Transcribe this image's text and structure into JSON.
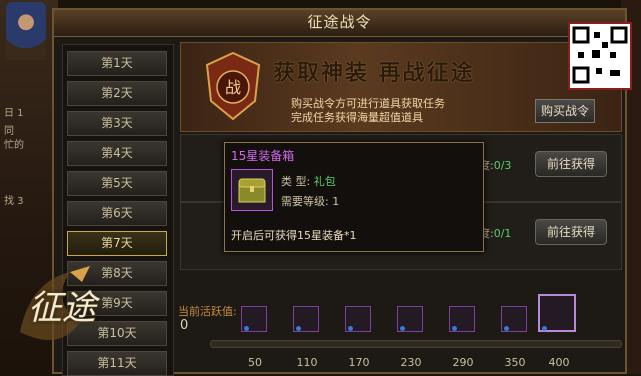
{
  "window": {
    "title": "征途战令"
  },
  "days": [
    "第1天",
    "第2天",
    "第3天",
    "第4天",
    "第5天",
    "第6天",
    "第7天",
    "第8天",
    "第9天",
    "第10天",
    "第11天"
  ],
  "active_day": "第7天",
  "banner": {
    "title": "获取神装 再战征途",
    "emblem_char": "战",
    "line1": "购买战令方可进行道具获取任务",
    "line2": "完成任务获得海量超值道具",
    "buy_button": "购买战令"
  },
  "tasks": [
    {
      "progress_label": "度:",
      "progress_value": "0/3",
      "button": "前往获得"
    },
    {
      "progress_label": "度:",
      "progress_value": "0/1",
      "button": "前往获得"
    }
  ],
  "tooltip": {
    "title": "15星装备箱",
    "type_label": "类 型:",
    "type_value": "礼包",
    "level_label": "需要等级:",
    "level_value": "1",
    "description": "开启后可获得15星装备*1"
  },
  "activity": {
    "label": "当前活跃值:",
    "value": "0",
    "milestones": [
      "50",
      "110",
      "170",
      "230",
      "290",
      "350",
      "400"
    ]
  },
  "chat_fragments": [
    "日 1",
    "同",
    "忙的",
    "找 3"
  ],
  "logo_text": "征途",
  "colors": {
    "accent_gold": "#c9a94a",
    "progress_green": "#57d06a",
    "tooltip_purple": "#d36aee"
  }
}
